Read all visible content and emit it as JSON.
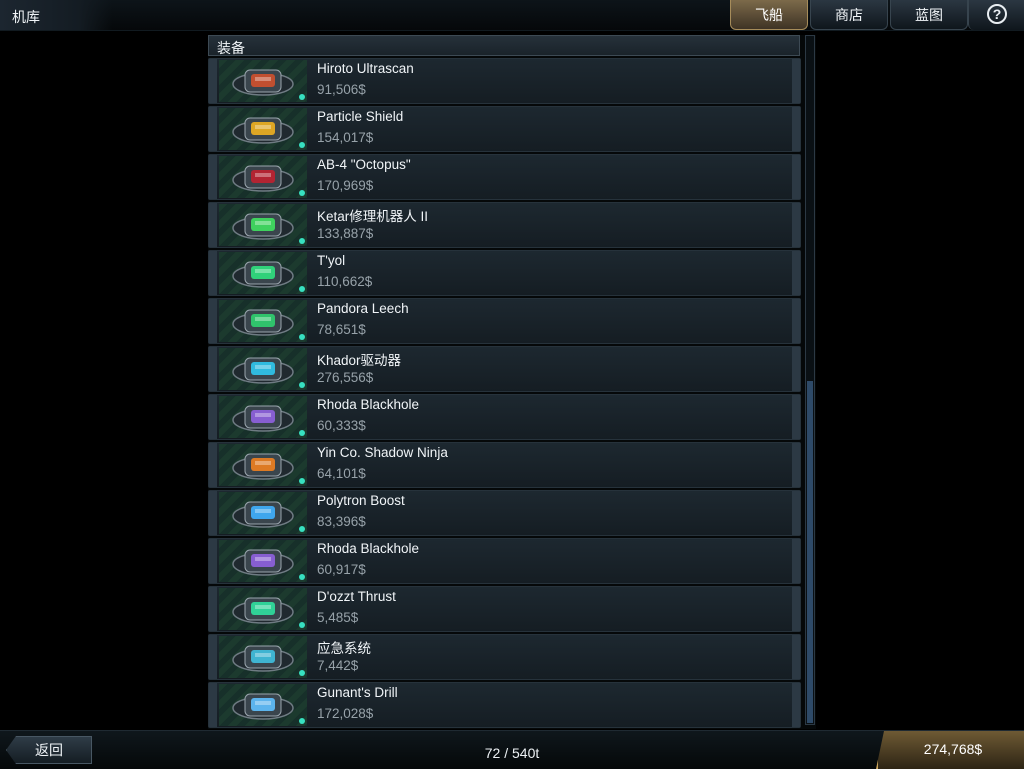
{
  "header": {
    "title": "机库",
    "tabs": [
      {
        "label": "飞船",
        "active": true
      },
      {
        "label": "商店",
        "active": false
      },
      {
        "label": "蓝图",
        "active": false
      }
    ],
    "help_icon": "help-icon"
  },
  "list": {
    "section_title": "装备",
    "items": [
      {
        "name": "Hiroto Ultrascan",
        "price": "91,506$",
        "icon": "scanner-icon",
        "accent": "#d0502e"
      },
      {
        "name": "Particle Shield",
        "price": "154,017$",
        "icon": "shield-generator-icon",
        "accent": "#f0b020"
      },
      {
        "name": "AB-4 \"Octopus\"",
        "price": "170,969$",
        "icon": "missile-launcher-icon",
        "accent": "#c02030"
      },
      {
        "name": "Ketar修理机器人 II",
        "price": "133,887$",
        "icon": "repair-bot-icon",
        "accent": "#40e060"
      },
      {
        "name": "T'yol",
        "price": "110,662$",
        "icon": "armor-plate-icon",
        "accent": "#30e080"
      },
      {
        "name": "Pandora Leech",
        "price": "78,651$",
        "icon": "energy-leech-icon",
        "accent": "#30d070"
      },
      {
        "name": "Khador驱动器",
        "price": "276,556$",
        "icon": "drive-core-icon",
        "accent": "#30c8f0"
      },
      {
        "name": "Rhoda Blackhole",
        "price": "60,333$",
        "icon": "blackhole-generator-icon",
        "accent": "#9060e0"
      },
      {
        "name": "Yin Co. Shadow Ninja",
        "price": "64,101$",
        "icon": "cloak-device-icon",
        "accent": "#f08020"
      },
      {
        "name": "Polytron Boost",
        "price": "83,396$",
        "icon": "booster-icon",
        "accent": "#40b0ff"
      },
      {
        "name": "Rhoda Blackhole",
        "price": "60,917$",
        "icon": "blackhole-generator-icon",
        "accent": "#9060e0"
      },
      {
        "name": "D'ozzt Thrust",
        "price": "5,485$",
        "icon": "thruster-icon",
        "accent": "#30e0a0"
      },
      {
        "name": "应急系统",
        "price": "7,442$",
        "icon": "emergency-system-icon",
        "accent": "#40c0e0"
      },
      {
        "name": "Gunant's Drill",
        "price": "172,028$",
        "icon": "mining-drill-icon",
        "accent": "#60c0ff"
      }
    ]
  },
  "footer": {
    "back_label": "返回",
    "cargo": "72 / 540t",
    "credits": "274,768$"
  },
  "colors": {
    "active_tab": "#7c6a4a",
    "credits_plate": "#6e5a34",
    "status_dot": "#37e0c0"
  }
}
